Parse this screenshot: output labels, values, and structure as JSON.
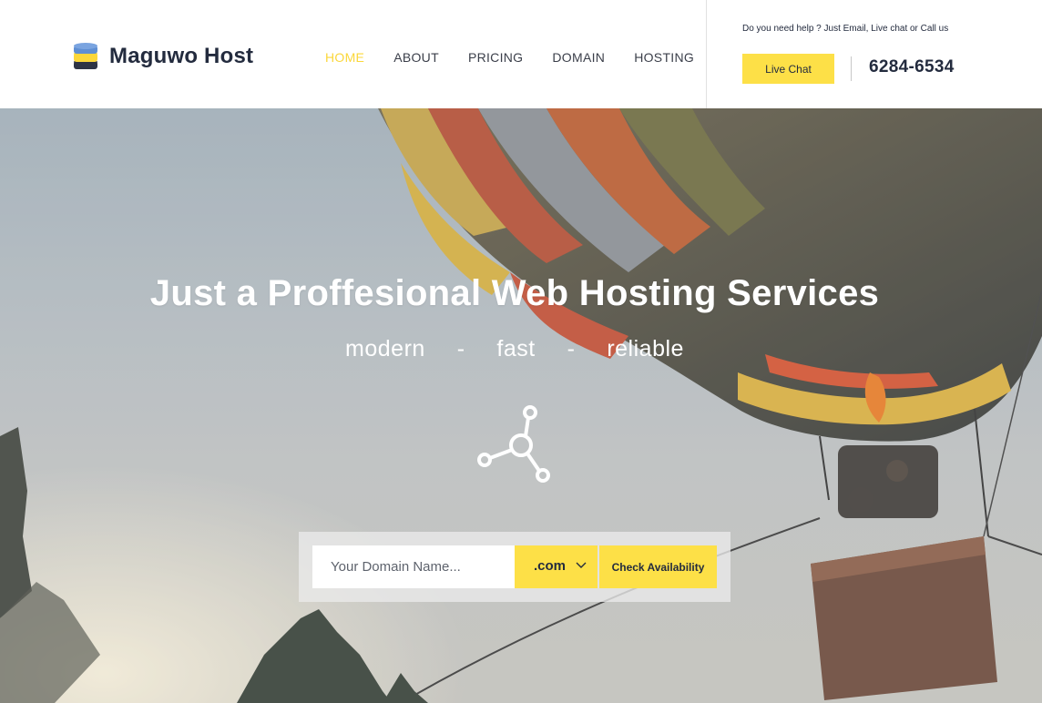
{
  "brand": {
    "name": "Maguwo Host"
  },
  "nav": {
    "items": [
      {
        "label": "HOME",
        "active": true
      },
      {
        "label": "ABOUT",
        "active": false
      },
      {
        "label": "PRICING",
        "active": false
      },
      {
        "label": "DOMAIN",
        "active": false
      },
      {
        "label": "HOSTING",
        "active": false
      }
    ]
  },
  "contact": {
    "help_text": "Do you need help ? Just Email, Live chat or Call us",
    "live_chat_label": "Live Chat",
    "phone": "6284-6534"
  },
  "hero": {
    "title": "Just a Proffesional Web Hosting Services",
    "subtitle": "modern  -  fast  -  reliable"
  },
  "search": {
    "placeholder": "Your Domain Name...",
    "tld": ".com",
    "button_label": "Check Availability"
  },
  "icons": {
    "logo": "database-stack-icon",
    "hero": "network-nodes-icon",
    "dropdown": "chevron-down-icon"
  },
  "colors": {
    "accent": "#fde047",
    "active_nav": "#fbd73a",
    "text_dark": "#232b3e"
  }
}
